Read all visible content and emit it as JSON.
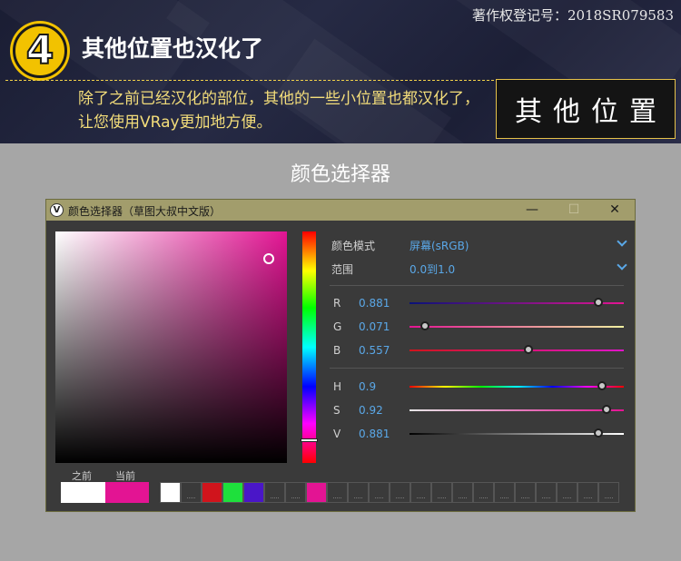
{
  "banner": {
    "copyright": "著作权登记号：2018SR079583",
    "step_number": "4",
    "step_title": "其他位置也汉化了",
    "description": "除了之前已经汉化的部位，其他的一些小位置也都汉化了，让您使用VRay更加地方便。",
    "tag": "其他位置"
  },
  "dialog_heading": "颜色选择器",
  "window": {
    "title": "颜色选择器（草图大叔中文版）",
    "icon": "vray-logo-icon",
    "buttons": {
      "minimize": "—",
      "maximize": "☐",
      "close": "✕"
    }
  },
  "picker": {
    "color_mode_label": "颜色模式",
    "color_mode_value": "屏幕(sRGB)",
    "range_label": "范围",
    "range_value": "0.0到1.0",
    "rgb": [
      {
        "label": "R",
        "value": "0.881",
        "fraction": 0.881
      },
      {
        "label": "G",
        "value": "0.071",
        "fraction": 0.071
      },
      {
        "label": "B",
        "value": "0.557",
        "fraction": 0.557
      }
    ],
    "hsv": [
      {
        "label": "H",
        "value": "0.9",
        "fraction": 0.9
      },
      {
        "label": "S",
        "value": "0.92",
        "fraction": 0.92
      },
      {
        "label": "V",
        "value": "0.881",
        "fraction": 0.881
      }
    ],
    "hue_fraction": 0.9,
    "saturation_fraction": 0.92,
    "value_fraction": 0.881,
    "previous_label": "之前",
    "current_label": "当前",
    "previous_color": "#ffffff",
    "current_color": "#e31493",
    "palette": [
      "#ffffff",
      "",
      "#d0141c",
      "#1ee03c",
      "#4a16c8",
      "",
      "",
      "#e31493",
      "",
      "",
      "",
      "",
      "",
      "",
      "",
      "",
      "",
      "",
      "",
      "",
      "",
      ""
    ]
  },
  "colors": {
    "accent": "#5aa8e8",
    "title_bar": "#a29d6c",
    "highlight": "#f3dd7a"
  }
}
